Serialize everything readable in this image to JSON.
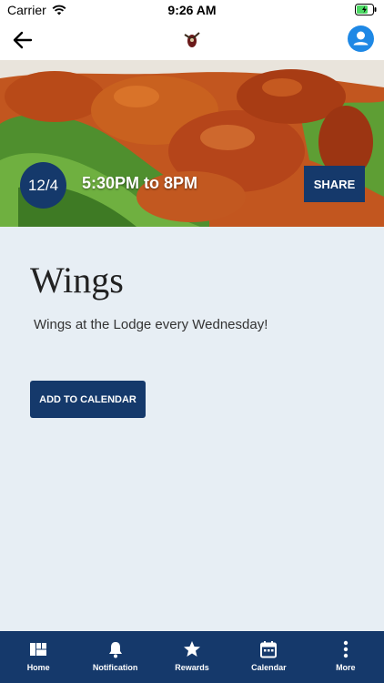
{
  "status_bar": {
    "carrier": "Carrier",
    "time": "9:26 AM"
  },
  "nav": {
    "back_icon": "arrow-left-icon",
    "logo_icon": "lodge-logo-icon",
    "profile_icon": "user-icon"
  },
  "event": {
    "date": "12/4",
    "time": "5:30PM to 8PM",
    "share_label": "SHARE",
    "title": "Wings",
    "description": "Wings at the Lodge every Wednesday!",
    "add_to_calendar_label": "ADD TO CALENDAR"
  },
  "tab_bar": {
    "tabs": [
      {
        "label": "Home",
        "icon": "home-grid-icon"
      },
      {
        "label": "Notification",
        "icon": "bell-icon"
      },
      {
        "label": "Rewards",
        "icon": "star-icon"
      },
      {
        "label": "Calendar",
        "icon": "calendar-icon"
      },
      {
        "label": "More",
        "icon": "more-vertical-icon"
      }
    ]
  },
  "colors": {
    "primary_navy": "#15396b",
    "accent_blue": "#1e88e5",
    "background": "#e7eef4"
  }
}
